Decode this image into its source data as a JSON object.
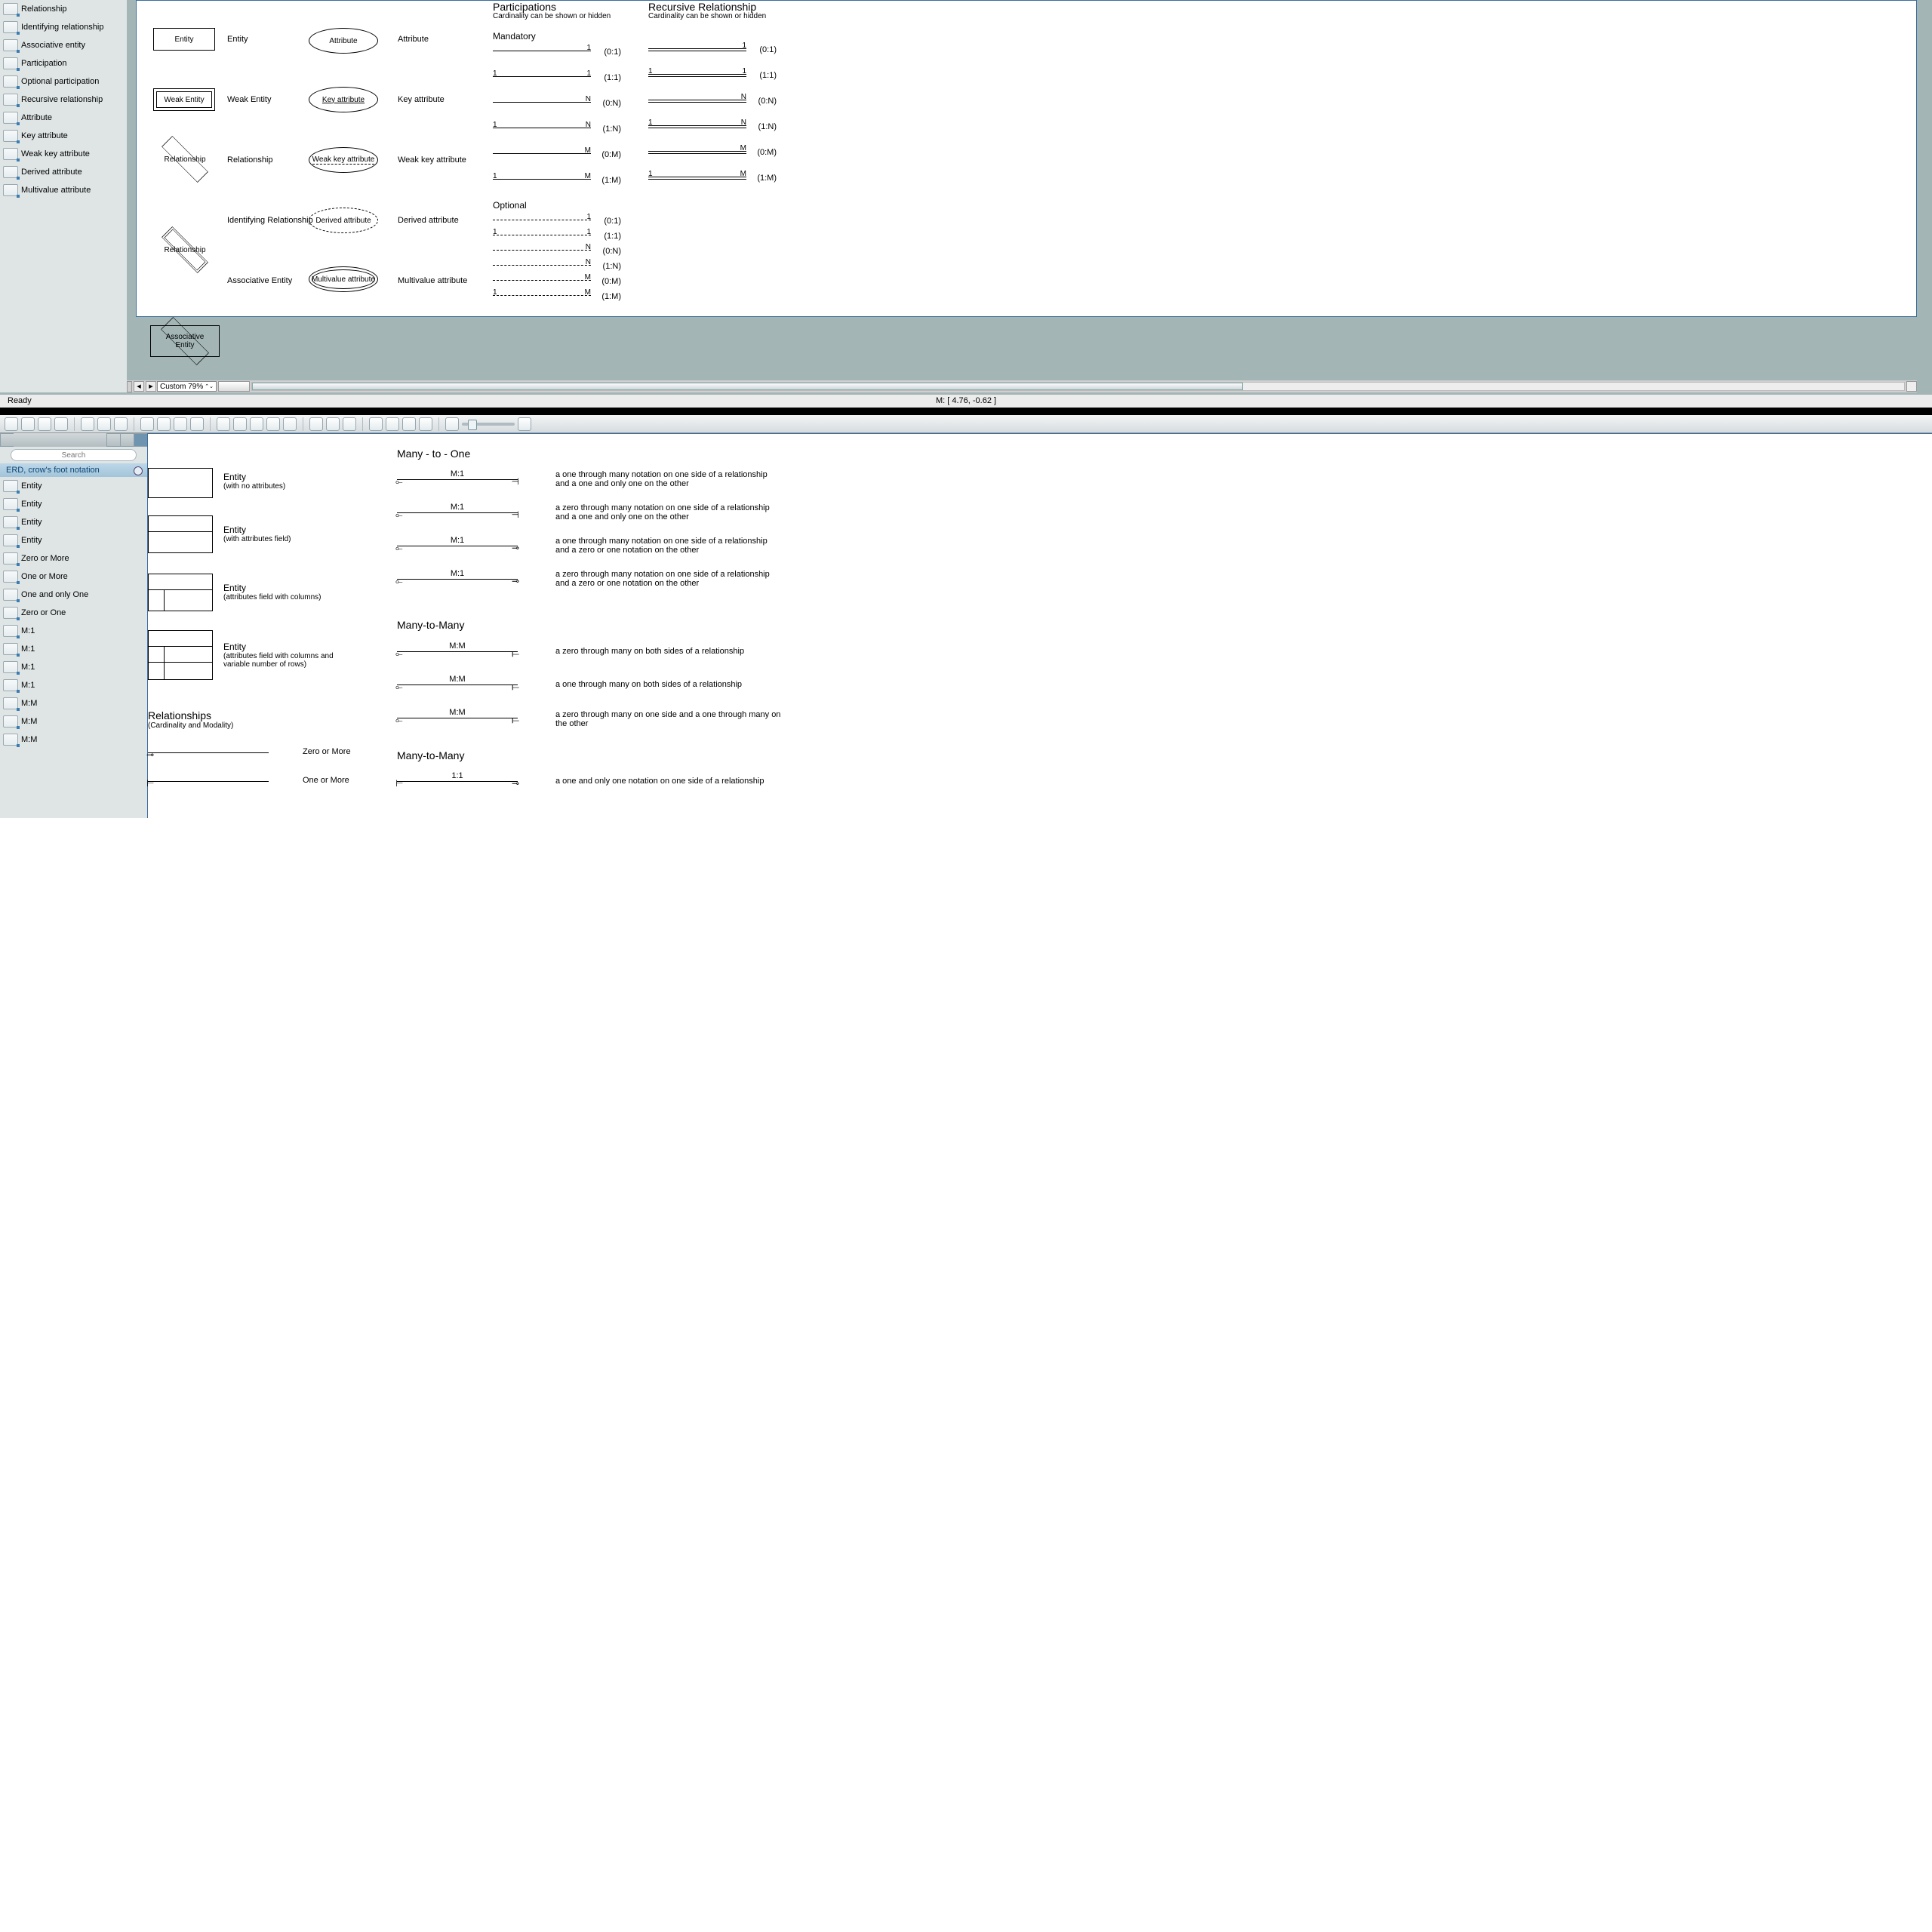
{
  "chen_library": {
    "items": [
      {
        "label": "Relationship"
      },
      {
        "label": "Identifying relationship"
      },
      {
        "label": "Associative entity"
      },
      {
        "label": "Participation"
      },
      {
        "label": "Optional participation"
      },
      {
        "label": "Recursive relationship"
      },
      {
        "label": "Attribute"
      },
      {
        "label": "Key attribute"
      },
      {
        "label": "Weak key attribute"
      },
      {
        "label": "Derived attribute"
      },
      {
        "label": "Multivalue attribute"
      }
    ]
  },
  "chen_canvas": {
    "entity": {
      "shape": "Entity",
      "label": "Entity"
    },
    "weak_entity": {
      "shape": "Weak Entity",
      "label": "Weak Entity"
    },
    "relationship": {
      "shape": "Relationship",
      "label": "Relationship"
    },
    "ident_rel": {
      "shape": "Relationship",
      "label": "Identifying Relationship"
    },
    "assoc_entity": {
      "shape_l1": "Associative",
      "shape_l2": "Entity",
      "label": "Associative Entity"
    },
    "attribute": {
      "shape": "Attribute",
      "label": "Attribute"
    },
    "key_attr": {
      "shape": "Key attribute",
      "label": "Key attribute"
    },
    "weak_key_attr": {
      "shape": "Weak key attribute",
      "label": "Weak key attribute"
    },
    "derived_attr": {
      "shape": "Derived attribute",
      "label": "Derived attribute"
    },
    "multi_attr": {
      "shape": "Multivalue attribute",
      "label": "Multivalue attribute"
    },
    "participations_hdr": "Participations",
    "participations_sub": "Cardinality can be shown or hidden",
    "recursive_hdr": "Recursive Relationship",
    "recursive_sub": "Cardinality can be shown or hidden",
    "mandatory": "Mandatory",
    "optional": "Optional",
    "mand_rows": [
      {
        "l": "",
        "r": "1",
        "ratio": "(0:1)"
      },
      {
        "l": "1",
        "r": "1",
        "ratio": "(1:1)"
      },
      {
        "l": "",
        "r": "N",
        "ratio": "(0:N)"
      },
      {
        "l": "1",
        "r": "N",
        "ratio": "(1:N)"
      },
      {
        "l": "",
        "r": "M",
        "ratio": "(0:M)"
      },
      {
        "l": "1",
        "r": "M",
        "ratio": "(1:M)"
      }
    ],
    "rec_rows": [
      {
        "l": "",
        "r": "1",
        "ratio": "(0:1)"
      },
      {
        "l": "1",
        "r": "1",
        "ratio": "(1:1)"
      },
      {
        "l": "",
        "r": "N",
        "ratio": "(0:N)"
      },
      {
        "l": "1",
        "r": "N",
        "ratio": "(1:N)"
      },
      {
        "l": "",
        "r": "M",
        "ratio": "(0:M)"
      },
      {
        "l": "1",
        "r": "M",
        "ratio": "(1:M)"
      }
    ],
    "opt_rows": [
      {
        "l": "",
        "r": "1",
        "ratio": "(0:1)"
      },
      {
        "l": "1",
        "r": "1",
        "ratio": "(1:1)"
      },
      {
        "l": "",
        "r": "N",
        "ratio": "(0:N)"
      },
      {
        "l": "",
        "r": "N",
        "ratio": "(1:N)"
      },
      {
        "l": "",
        "r": "M",
        "ratio": "(0:M)"
      },
      {
        "l": "1",
        "r": "M",
        "ratio": "(1:M)"
      }
    ]
  },
  "status": {
    "ready": "Ready",
    "zoom": "Custom 79%",
    "mouse": "M: [ 4.76, -0.62 ]"
  },
  "crow_library": {
    "search_placeholder": "Search",
    "group_title": "ERD, crow's foot notation",
    "items": [
      {
        "label": "Entity"
      },
      {
        "label": "Entity"
      },
      {
        "label": "Entity"
      },
      {
        "label": "Entity"
      },
      {
        "label": "Zero or More"
      },
      {
        "label": "One or More"
      },
      {
        "label": "One and only One"
      },
      {
        "label": "Zero or One"
      },
      {
        "label": "M:1"
      },
      {
        "label": "M:1"
      },
      {
        "label": "M:1"
      },
      {
        "label": "M:1"
      },
      {
        "label": "M:M"
      },
      {
        "label": "M:M"
      },
      {
        "label": "M:M"
      }
    ]
  },
  "crow_canvas": {
    "entities": [
      {
        "title": "Entity",
        "sub": "(with no attributes)"
      },
      {
        "title": "Entity",
        "sub": "(with attributes field)"
      },
      {
        "title": "Entity",
        "sub": "(attributes field with columns)"
      },
      {
        "title": "Entity",
        "sub": "(attributes field with columns and variable number of rows)"
      }
    ],
    "rel_hdr": "Relationships",
    "rel_sub": "(Cardinality and Modality)",
    "basic_rels": [
      {
        "label": "Zero or More"
      },
      {
        "label": "One or More"
      }
    ],
    "m1_hdr": "Many - to - One",
    "m1": [
      {
        "cap": "M:1",
        "desc": "a one through many notation on one side of a relationship and a one and only one on the other"
      },
      {
        "cap": "M:1",
        "desc": "a zero through many notation on one side of a relationship and a one and only one on the other"
      },
      {
        "cap": "M:1",
        "desc": "a one through many notation on one side of a relationship and a zero or one notation on the other"
      },
      {
        "cap": "M:1",
        "desc": "a zero through many notation on one side of a relationship and a zero or one notation on the other"
      }
    ],
    "mm_hdr": "Many-to-Many",
    "mm": [
      {
        "cap": "M:M",
        "desc": "a zero through many on both sides of a relationship"
      },
      {
        "cap": "M:M",
        "desc": "a one through many on both sides of a relationship"
      },
      {
        "cap": "M:M",
        "desc": "a zero through many on one side and a one through many on the other"
      }
    ],
    "oo_hdr": "Many-to-Many",
    "oo": [
      {
        "cap": "1:1",
        "desc": "a one and only one notation on one side of a relationship"
      }
    ]
  }
}
